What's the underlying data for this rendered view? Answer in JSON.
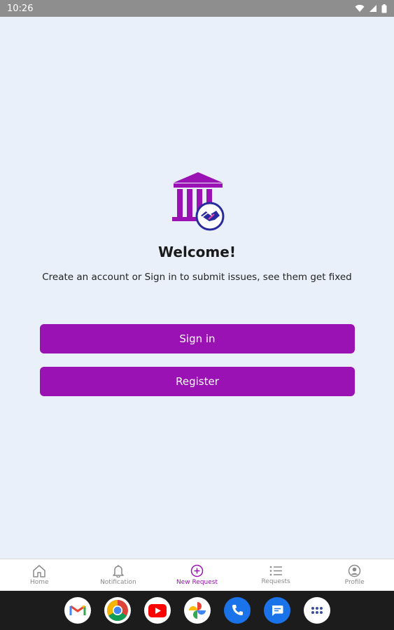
{
  "status_bar": {
    "time": "10:26"
  },
  "welcome": {
    "title": "Welcome!",
    "subtitle": "Create an account or Sign in to submit issues, see them get fixed"
  },
  "buttons": {
    "sign_in": "Sign in",
    "register": "Register"
  },
  "bottom_nav": {
    "items": [
      {
        "label": "Home",
        "icon": "home-icon"
      },
      {
        "label": "Notification",
        "icon": "bell-icon"
      },
      {
        "label": "New Request",
        "icon": "add-circle-icon",
        "active": true
      },
      {
        "label": "Requests",
        "icon": "list-icon"
      },
      {
        "label": "Profile",
        "icon": "profile-icon"
      }
    ]
  },
  "dock_apps": [
    "gmail-icon",
    "chrome-icon",
    "youtube-icon",
    "photos-icon",
    "phone-icon",
    "messages-icon",
    "app-drawer-icon"
  ],
  "colors": {
    "accent": "#9a12b3",
    "background": "#e9f0fa",
    "logo_navy": "#2a2aa0"
  }
}
